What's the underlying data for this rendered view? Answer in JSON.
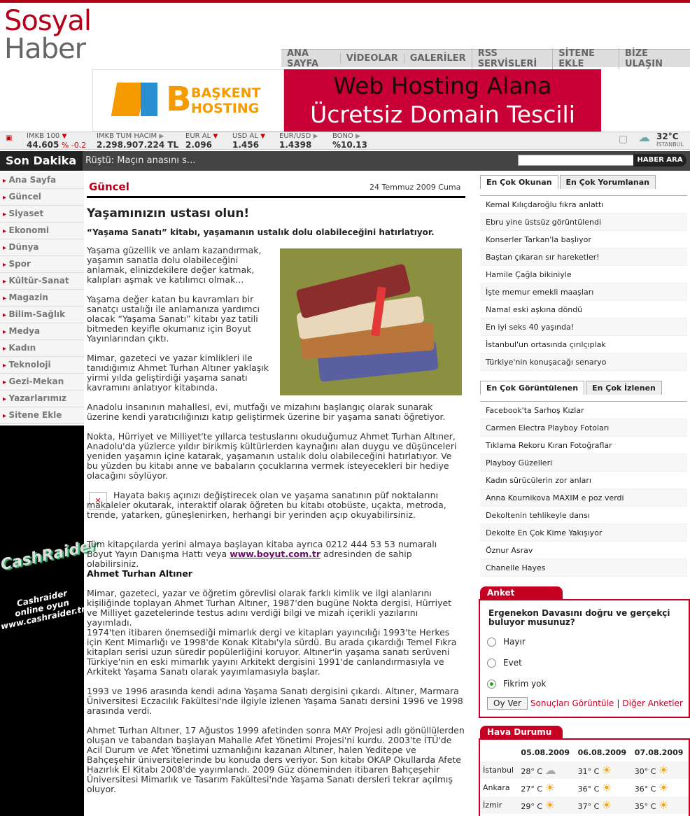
{
  "logo": {
    "line1": "Sosyal",
    "line2": "Haber"
  },
  "nav": [
    "ANA SAYFA",
    "VİDEOLAR",
    "GALERİLER",
    "RSS SERVİSLERİ",
    "SİTENE EKLE",
    "BİZE ULAŞIN"
  ],
  "banner": {
    "logo_text1": "BAŞKENT",
    "logo_text2": "HOSTING",
    "line1": "Web Hosting Alana",
    "line2": "Ücretsiz Domain Tescili"
  },
  "ticker": [
    {
      "label": "IMKB 100",
      "value": "44.605",
      "change": "% -0.2"
    },
    {
      "label": "IMKB TUM HACIM",
      "value": "2.298.907.224 TL"
    },
    {
      "label": "EUR AL",
      "value": "2.096"
    },
    {
      "label": "USD AL",
      "value": "1.456"
    },
    {
      "label": "EUR/USD",
      "value": "1.4398"
    },
    {
      "label": "BONO",
      "value": "%10.13"
    }
  ],
  "weather_top": {
    "temp": "32°C",
    "city": "İSTANBUL"
  },
  "breaking": {
    "label": "Son Dakika",
    "text": "Rüştü: Maçın anasını s...",
    "search_button": "HABER ARA"
  },
  "sidebar": [
    "Ana Sayfa",
    "Güncel",
    "Siyaset",
    "Ekonomi",
    "Dünya",
    "Spor",
    "Kültür-Sanat",
    "Magazin",
    "Bilim-Sağlık",
    "Medya",
    "Kadın",
    "Teknoloji",
    "Gezi-Mekan",
    "Yazarlarımız",
    "Sitene Ekle"
  ],
  "ad_side": {
    "brand": "CashRaider",
    "l1": "Cashraider",
    "l2": "online oyun",
    "l3": "www.cashraider.tr"
  },
  "article": {
    "section": "Güncel",
    "date": "24 Temmuz 2009 Cuma",
    "title": "Yaşamınızın ustası olun!",
    "lede": "“Yaşama Sanatı” kitabı, yaşamanın ustalık dolu olabileceğini hatırlatıyor.",
    "p1": "Yaşama güzellik ve anlam kazandırmak, yaşamın sanatla dolu olabileceğini anlamak, elinizdekilere değer katmak, kalıpları aşmak ve katılımcı olmak...",
    "p2": "Yaşama değer katan bu kavramları bir sanatçı ustalığı ile anlamanıza yardımcı olacak “Yaşama Sanatı” kitabı yaz tatili bitmeden keyifle okumanız için Boyut Yayınlarından çıktı.",
    "p3": "Mimar, gazeteci ve yazar kimlikleri ile tanıdığımız Ahmet Turhan Altıner yaklaşık yirmi yılda geliştirdiği yaşama sanatı kavramını anlatıyor kitabında.",
    "p4": "Anadolu insanının mahallesi, evi, mutfağı ve mizahını başlangıç olarak sunarak üzerine kendi yaratıcılığınızı katıp geliştirmek üzerine bir yaşama sanatı öğretiyor.",
    "p5": "Nokta, Hürriyet ve Milliyet'te yıllarca testuslarını okuduğumuz Ahmet Turhan Altıner, Anadolu'da yüzlerce yıldır birikmiş kültürlerden kaynağını alan duygu ve düşünceleri yeniden yaşamın içine katarak, yaşamanın ustalık dolu olabileceğini hatırlatıyor. Ve bu yüzden bu kitabı anne ve babaların çocuklarına vermek isteyecekleri bir hediye olacağını söylüyor.",
    "p6": "Hayata bakış açınızı değiştirecek olan ve yaşama sanatının püf noktalarını makaleler okutarak, interaktif olarak öğreten bu kitabı otobüste, uçakta, metroda, trende, yatarken, güneşlenirken, herhangi bir yerinden açıp okuyabilirsiniz.",
    "p7a": "Tüm kitapçılarda yerini almaya başlayan kitaba ayrıca 0212 444 53 53 numaralı Boyut Yayın Danışma Hattı veya ",
    "p7link": "www.boyut.com.tr",
    "p7b": " adresinden de sahip olabilirsiniz.",
    "sub": "Ahmet Turhan Altıner",
    "p8": "Mimar, gazeteci, yazar ve öğretim görevlisi olarak farklı kimlik ve ilgi alanlarını kişiliğinde toplayan Ahmet Turhan Altıner, 1987'den bugüne Nokta dergisi, Hürriyet ve Milliyet gazetelerinde testus adını verdiği bilgi ve mizah içerikli yazılarını yayımladı.",
    "p9": "1974'ten itibaren önemsediği mimarlık dergi ve kitapları yayıncılığı 1993'te Herkes için Kent Mimarlığı ve 1998'de Konak Kitabı'yla sürdü. Bu arada çıkardığı Temel Fıkra kitapları serisi uzun süredir popülerliğini koruyor. Altıner'in yaşama sanatı serüveni Türkiye'nin en eski mimarlık yayını Arkitekt dergisini 1991'de canlandırmasıyla ve Arkitekt Yaşama Sanatı olarak yayımlamasıyla başlar.",
    "p10": "1993 ve 1996 arasında kendi adına Yaşama Sanatı dergisini çıkardı. Altıner, Marmara Üniversitesi Eczacılık Fakültesi'nde ilgiyle izlenen Yaşama Sanatı dersini 1996 ve 1998 arasında verdi.",
    "p11": "Ahmet Turhan Altıner, 17 Ağustos 1999 afetinden sonra MAY Projesi adlı gönüllülerden oluşan ve tabandan başlayan Mahalle Afet Yönetimi Projesi'ni kurdu. 2003'te İTÜ'de Acil Durum ve Afet Yönetimi uzmanlığını kazanan Altıner, halen Yeditepe ve Bahçeşehir üniversitelerinde bu konuda ders veriyor. Son kitabı OKAP Okullarda Afete Hazırlık El Kitabı 2008'de yayımlandı. 2009 Güz döneminden itibaren Bahçeşehir Üniversitesi Mimarlık ve Tasarım Fakültesi'nde Yaşama Sanatı dersleri tekrar açılmış oluyor."
  },
  "tabs1": {
    "t1": "En Çok Okunan",
    "t2": "En Çok Yorumlanan",
    "items": [
      "Kemal Kılıçdaroğlu fıkra anlattı",
      "Ebru yine üstsüz görüntülendi",
      "Konserler Tarkan'la başlıyor",
      "Baştan çıkaran sır hareketler!",
      "Hamile Çağla bikiniyle",
      "İşte memur emekli maaşları",
      "Namal eski aşkına döndü",
      "En iyi seks 40 yaşında!",
      "İstanbul'un ortasında çırılçıplak",
      "Türkiye'nin konuşacağı senaryo"
    ]
  },
  "tabs2": {
    "t1": "En Çok Görüntülenen",
    "t2": "En Çok İzlenen",
    "items": [
      "Facebook'ta Sarhoş Kızlar",
      "Carmen Electra Playboy Fotoları",
      "Tıklama Rekoru Kıran Fotoğraflar",
      "Playboy Güzelleri",
      "Kadın sürücülerin zor anları",
      "Anna Kournikova MAXIM e poz verdi",
      "Dekoltenin tehlikeyle dansı",
      "Dekolte En Çok Kime Yakışıyor",
      "Öznur Asrav",
      "Chanelle Hayes"
    ]
  },
  "poll": {
    "header": "Anket",
    "question": "Ergenekon Davasını doğru ve gerçekçi buluyor musunuz?",
    "options": [
      "Hayır",
      "Evet",
      "Fikrim yok"
    ],
    "vote": "Oy Ver",
    "results": "Sonuçları Görüntüle",
    "sep": "|",
    "others": "Diğer Anketler"
  },
  "weather": {
    "header": "Hava Durumu",
    "dates": [
      "05.08.2009",
      "06.08.2009",
      "07.08.2009"
    ],
    "rows": [
      {
        "city": "İstanbul",
        "t": [
          "28° C",
          "31° C",
          "30° C"
        ]
      },
      {
        "city": "Ankara",
        "t": [
          "27° C",
          "36° C",
          "36° C"
        ]
      },
      {
        "city": "İzmir",
        "t": [
          "29° C",
          "37° C",
          "35° C"
        ]
      }
    ]
  }
}
